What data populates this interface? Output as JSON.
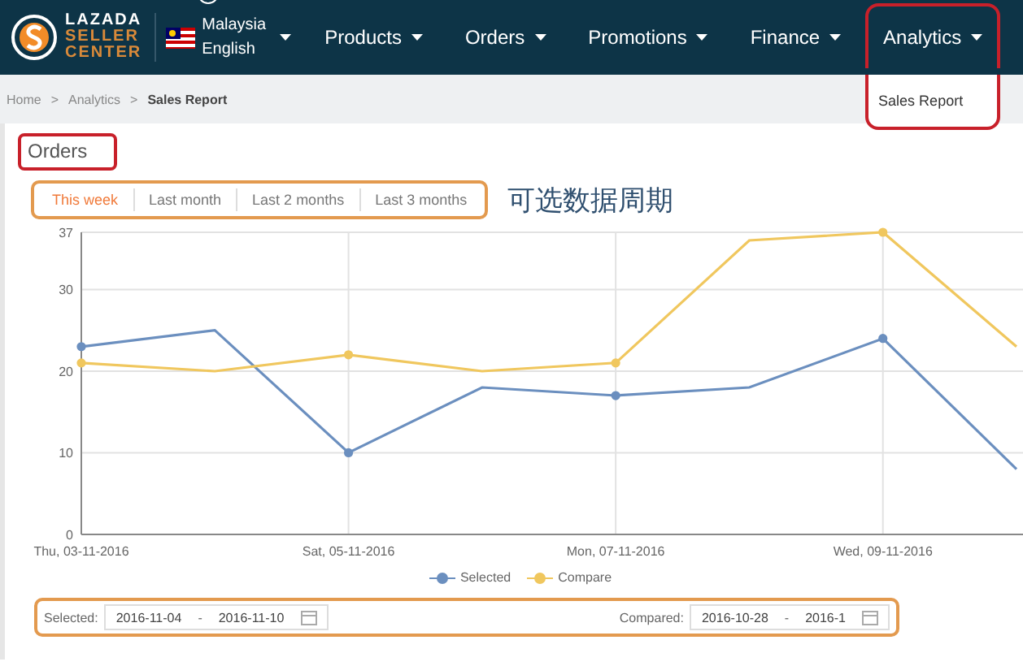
{
  "navbar": {
    "logo_lines": [
      "LAZADA",
      "SELLER",
      "CENTER"
    ],
    "country": "Malaysia",
    "language": "English",
    "menu": [
      {
        "label": "Products",
        "selected": false
      },
      {
        "label": "Orders",
        "selected": false
      },
      {
        "label": "Promotions",
        "selected": false
      },
      {
        "label": "Finance",
        "selected": false
      },
      {
        "label": "Analytics",
        "selected": true
      }
    ],
    "dropdown": [
      "Sales Report"
    ]
  },
  "breadcrumb": [
    "Home",
    "Analytics",
    "Sales Report"
  ],
  "breadcrumb_separators": [
    ">",
    ">"
  ],
  "section_title": "Orders",
  "period_tabs": [
    {
      "label": "This week",
      "selected": true
    },
    {
      "label": "Last month",
      "selected": false
    },
    {
      "label": "Last 2 months",
      "selected": false
    },
    {
      "label": "Last 3 months",
      "selected": false
    }
  ],
  "annotation": "可选数据周期",
  "chart": {
    "chart_data": {
      "type": "line",
      "categories": [
        "Thu, 03-11-2016",
        null,
        "Sat, 05-11-2016",
        null,
        "Mon, 07-11-2016",
        null,
        "Wed, 09-11-2016",
        null
      ],
      "ylim": [
        0,
        37
      ],
      "grid": true,
      "yticks": [
        0,
        10,
        20,
        30,
        37
      ],
      "series": [
        {
          "name": "Selected",
          "color": "#6b8fbf",
          "values": [
            23,
            25,
            10,
            18,
            17,
            18,
            24,
            8
          ]
        },
        {
          "name": "Compare",
          "color": "#f0c75e",
          "values": [
            21,
            20,
            22,
            20,
            21,
            36,
            37,
            23
          ]
        }
      ]
    }
  },
  "date_bar": {
    "selected_label": "Selected:",
    "selected_from": "2016-11-04",
    "selected_dash": "-",
    "selected_to": "2016-11-10",
    "compared_label": "Compared:",
    "compared_from": "2016-10-28",
    "compared_dash": "-",
    "compared_to": "2016-1"
  }
}
